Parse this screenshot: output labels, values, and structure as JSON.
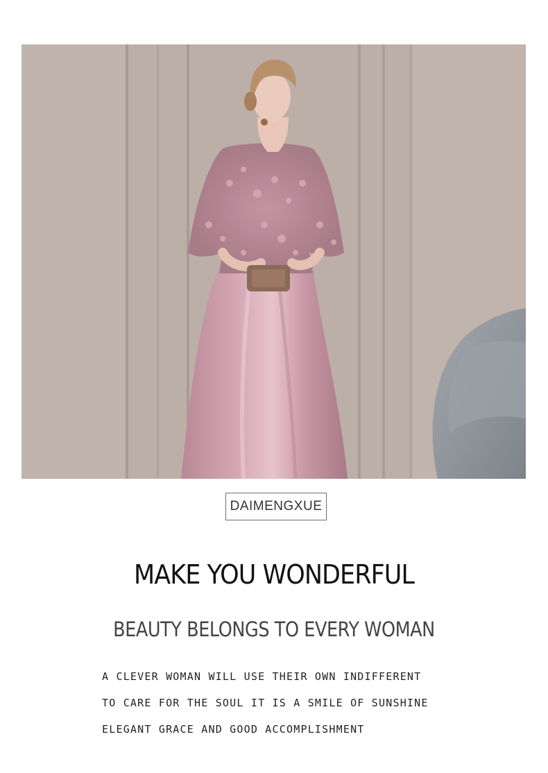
{
  "hero": {
    "image_alt": "Woman in a pink satin evening gown with lace floral bodice standing beside a grey swan chair"
  },
  "brand": {
    "name": "DAIMENGXUE"
  },
  "headline": "MAKE YOU WONDERFUL",
  "subheadline": "BEAUTY BELONGS TO EVERY WOMAN",
  "body_lines": [
    "A CLEVER WOMAN WILL USE THEIR OWN INDIFFERENT",
    "TO CARE FOR THE SOUL IT IS A SMILE OF SUNSHINE",
    "ELEGANT GRACE AND GOOD ACCOMPLISHMENT"
  ],
  "colors": {
    "dress": "#c99aa8",
    "wall": "#bdb1aa",
    "chair": "#8f949b",
    "text_dark": "#111111",
    "text_mid": "#444444"
  }
}
